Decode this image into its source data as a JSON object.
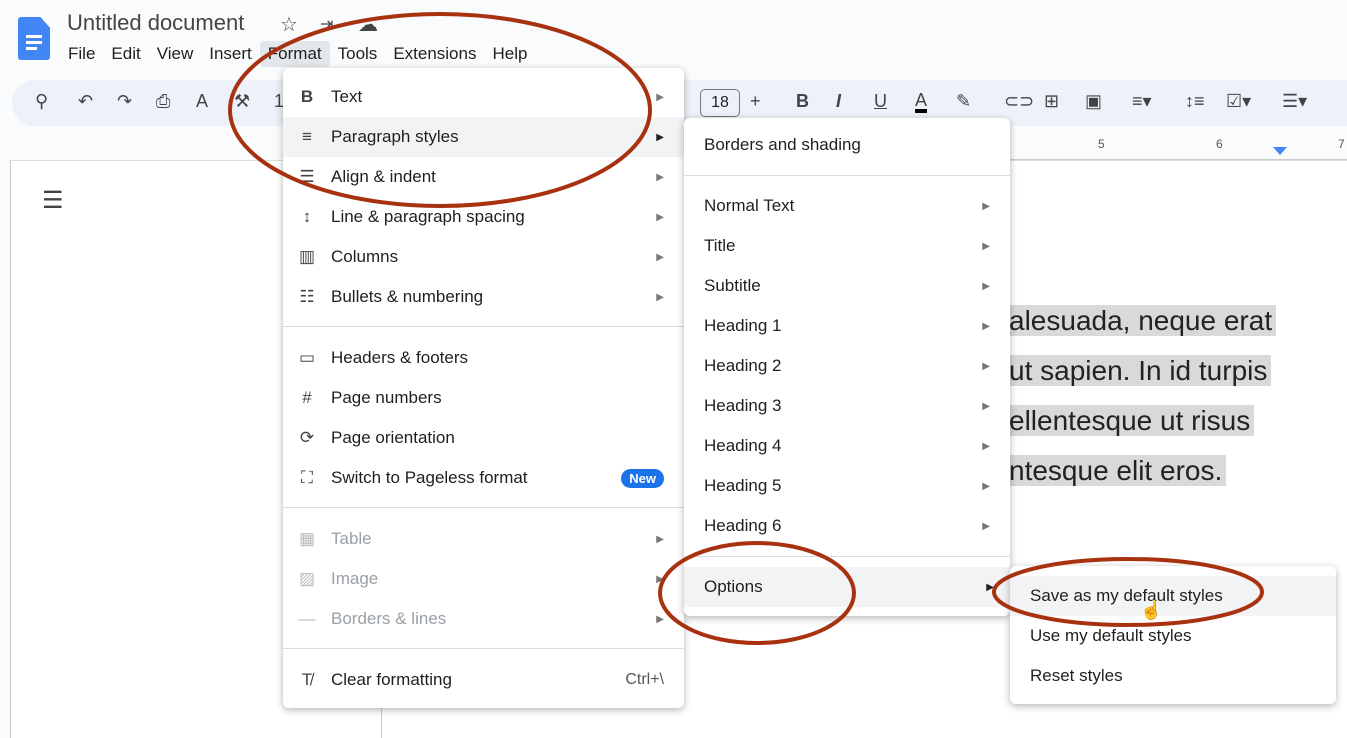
{
  "app": {
    "title": "Untitled document",
    "icons": [
      "star-icon",
      "move-to-folder-icon",
      "cloud-saved-icon"
    ]
  },
  "menubar": [
    "File",
    "Edit",
    "View",
    "Insert",
    "Format",
    "Tools",
    "Extensions",
    "Help"
  ],
  "toolbar": {
    "font_size": "18",
    "partial": "1",
    "ruler_marks": [
      "5",
      "6",
      "7"
    ]
  },
  "document": {
    "lines": [
      "alesuada, neque erat",
      "ut sapien. In id turpis",
      "ellentesque ut risus",
      "ntesque elit eros."
    ]
  },
  "format_menu": {
    "items": [
      {
        "label": "Text",
        "icon": "B"
      },
      {
        "label": "Paragraph styles",
        "icon": "≡"
      },
      {
        "label": "Align & indent",
        "icon": "☰"
      },
      {
        "label": "Line & paragraph spacing",
        "icon": "↕"
      },
      {
        "label": "Columns",
        "icon": "▥"
      },
      {
        "label": "Bullets & numbering",
        "icon": "☷"
      },
      {
        "label": "Headers & footers",
        "icon": "▭"
      },
      {
        "label": "Page numbers",
        "icon": "#"
      },
      {
        "label": "Page orientation",
        "icon": "⟳"
      },
      {
        "label": "Switch to Pageless format",
        "icon": "⛶",
        "badge": "New"
      },
      {
        "label": "Table",
        "icon": "▦"
      },
      {
        "label": "Image",
        "icon": "▨"
      },
      {
        "label": "Borders & lines",
        "icon": "—"
      },
      {
        "label": "Clear formatting",
        "icon": "T̸",
        "shortcut": "Ctrl+\\"
      }
    ]
  },
  "paragraph_styles_menu": {
    "items": [
      "Borders and shading",
      "Normal Text",
      "Title",
      "Subtitle",
      "Heading 1",
      "Heading 2",
      "Heading 3",
      "Heading 4",
      "Heading 5",
      "Heading 6",
      "Options"
    ]
  },
  "options_menu": {
    "items": [
      "Save as my default styles",
      "Use my default styles",
      "Reset styles"
    ]
  },
  "annotation_color": "#a8320f"
}
